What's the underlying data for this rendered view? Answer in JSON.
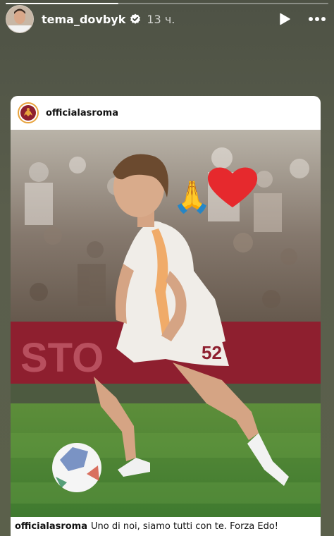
{
  "story": {
    "username": "tema_dovbyk",
    "time": "13 ч.",
    "progress": 0.35,
    "accent": "#ffffff"
  },
  "post": {
    "username": "officialasroma",
    "caption_user": "officialasroma",
    "caption_text": "Uno di noi, siamo tutti con te. Forza Edo!",
    "shirt_number": "52",
    "banner_text": "STO",
    "stickers": [
      "praying-hands-emoji",
      "red-heart-emoji"
    ],
    "colors": {
      "roma_red": "#8e1f2f",
      "roma_orange": "#f0a35b",
      "pitch": "#3f7a2f"
    }
  },
  "icons": [
    "verified-icon",
    "play-icon",
    "more-icon"
  ]
}
